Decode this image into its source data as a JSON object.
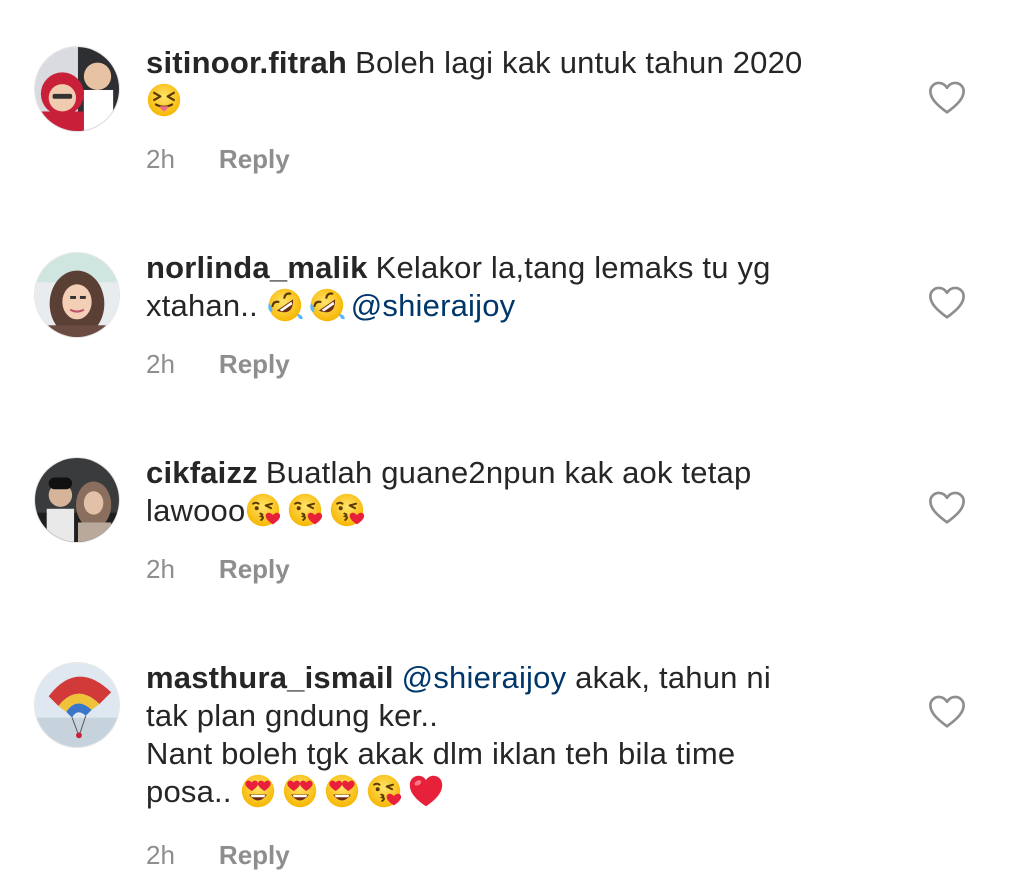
{
  "comments": [
    {
      "username": "sitinoor.fitrah",
      "text_1": "Boleh lagi kak untuk tahun 2020",
      "time": "2h",
      "reply": "Reply",
      "emojis": [
        "squinting-tongue-emoji"
      ]
    },
    {
      "username": "norlinda_malik",
      "text_1": "Kelakor la,tang lemaks tu yg",
      "text_2": "xtahan..",
      "mention": "@shieraijoy",
      "time": "2h",
      "reply": "Reply",
      "emojis": [
        "rolling-laughing-emoji",
        "rolling-laughing-emoji"
      ]
    },
    {
      "username": "cikfaizz",
      "text_1": "Buatlah guane2npun kak aok tetap",
      "text_2": "lawooo",
      "time": "2h",
      "reply": "Reply",
      "emojis": [
        "kissing-heart-emoji",
        "kissing-heart-emoji",
        "kissing-heart-emoji"
      ]
    },
    {
      "username": "masthura_ismail",
      "mention": "@shieraijoy",
      "text_1": "akak, tahun ni",
      "text_2": "tak plan gndung ker..",
      "text_3": "Nant boleh tgk akak dlm iklan teh bila time",
      "text_4": "posa..",
      "time": "2h",
      "reply": "Reply",
      "emojis": [
        "heart-eyes-emoji",
        "heart-eyes-emoji",
        "heart-eyes-emoji",
        "kissing-heart-emoji",
        "red-heart-emoji"
      ]
    }
  ],
  "icons": {
    "like": "heart-outline-icon"
  },
  "colors": {
    "mention": "#00376b",
    "meta": "#8e8e8e",
    "text": "#262626"
  }
}
